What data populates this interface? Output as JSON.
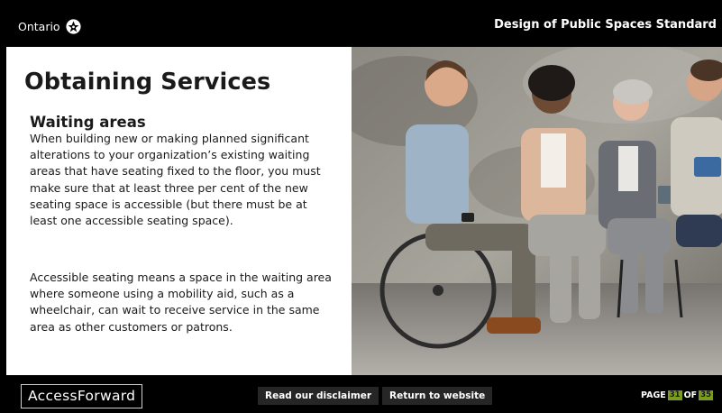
{
  "header": {
    "logo_text": "Ontario",
    "title": "Design of Public Spaces Standard"
  },
  "main": {
    "title": "Obtaining Services",
    "section_heading": "Waiting areas",
    "paragraph_1": "When building new or making planned significant alterations to your organization’s existing waiting areas that have seating fixed to the floor, you must make sure that at least three per cent of the new seating space is accessible (but there must be at least one accessible seating space).",
    "paragraph_2": "Accessible seating means a space in the waiting area where someone using a mobility aid, such as a wheelchair, can wait to receive service in the same area as other customers or patrons."
  },
  "photo": {
    "icon": "waiting-room-photo"
  },
  "footer": {
    "brand": "AccessForward",
    "disclaimer_label": "Read our disclaimer",
    "return_label": "Return to website",
    "page_prefix": "PAGE",
    "page_current": "31",
    "page_of": "OF",
    "page_total": "35"
  },
  "colors": {
    "background": "#000000",
    "content_bg": "#ffffff",
    "button_bg": "#262626",
    "page_badge": "#7a9b1f"
  }
}
